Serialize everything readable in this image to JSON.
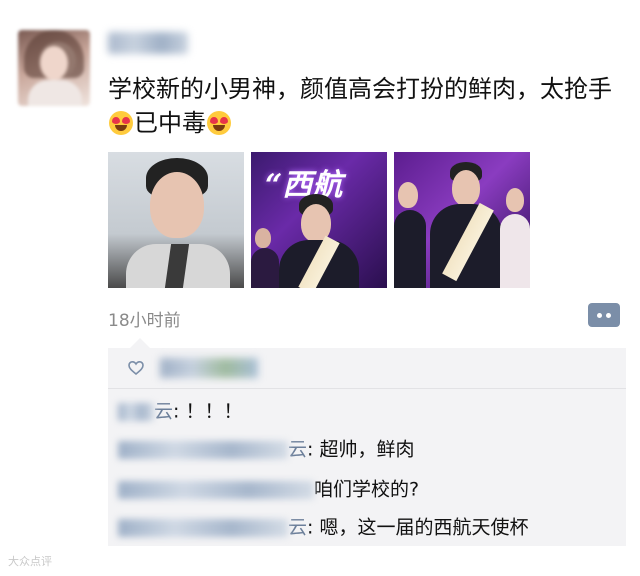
{
  "post": {
    "text_part1": "学校新的小男神，颜值高会打扮的鲜肉，太抢手",
    "text_part2": "已中毒",
    "emoji_icon": "heart-eyes-emoji",
    "time": "18小时前",
    "photo_banner": "“西航"
  },
  "comments": [
    {
      "name_suffix": "云",
      "text": ": ！！！"
    },
    {
      "name_suffix": "云",
      "text": ": 超帅，鲜肉"
    },
    {
      "name_suffix": "",
      "text": "咱们学校的?"
    },
    {
      "name_suffix": "云",
      "text": ": 嗯，这一届的西航天使杯"
    }
  ],
  "watermark": "大众点评",
  "colors": {
    "comment_button": "#7b8ea8",
    "panel_bg": "#f3f3f5",
    "emoji": "#ffcb3d"
  }
}
